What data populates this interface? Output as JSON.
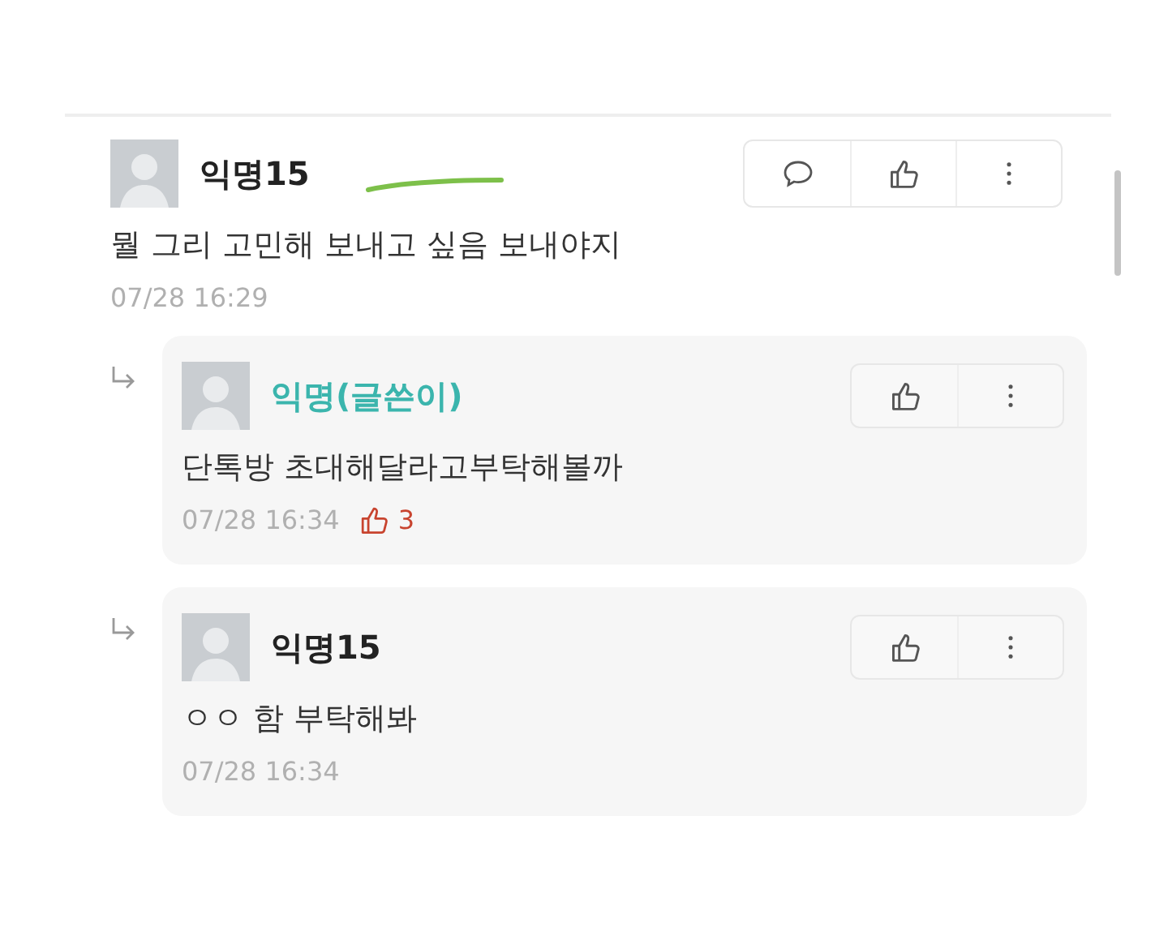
{
  "comments": [
    {
      "author": "익명15",
      "is_writer": false,
      "text": "뭘 그리 고민해 보내고 싶음 보내야지",
      "time": "07/28 16:29",
      "reply_button": true,
      "children": [
        {
          "author": "익명(글쓴이)",
          "is_writer": true,
          "text": "단톡방 초대해달라고부탁해볼까",
          "time": "07/28 16:34",
          "likes": "3",
          "reply_button": false
        },
        {
          "author": "익명15",
          "is_writer": false,
          "text": "ㅇㅇ 함 부탁해봐",
          "time": "07/28 16:34",
          "reply_button": false
        }
      ]
    }
  ]
}
